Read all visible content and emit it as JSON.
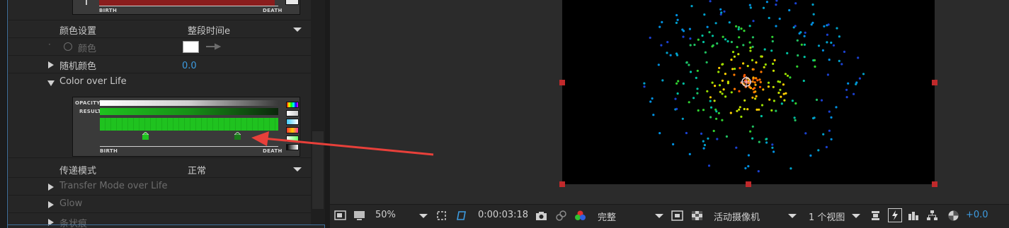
{
  "effect_controls": {
    "color_setting_label": "颜色设置",
    "color_setting_value": "整段时间e",
    "color_label": "颜色",
    "random_color_label": "随机颜色",
    "random_color_value": "0.0",
    "color_over_life_label": "Color over Life",
    "transfer_mode_label": "传递模式",
    "transfer_mode_value": "正常",
    "transfer_mode_over_life_label": "Transfer Mode over Life",
    "glow_label": "Glow",
    "streaklet_label": "条状痕"
  },
  "top_graph": {
    "birth": "BIRTH",
    "death": "DEATH"
  },
  "col_graph": {
    "opacity": "OPACITY",
    "result": "RESULT",
    "birth": "BIRTH",
    "death": "DEATH",
    "bar_color": "#1fc21f"
  },
  "viewer_toolbar": {
    "zoom": "50%",
    "timecode": "0:00:03:18",
    "quality": "完整",
    "camera": "活动摄像机",
    "views": "1 个视图",
    "exposure": "+0.0"
  },
  "colors": {
    "accent_blue": "#3d9be0",
    "handle_red": "#c0292b",
    "arrow_red": "#e8403a"
  }
}
